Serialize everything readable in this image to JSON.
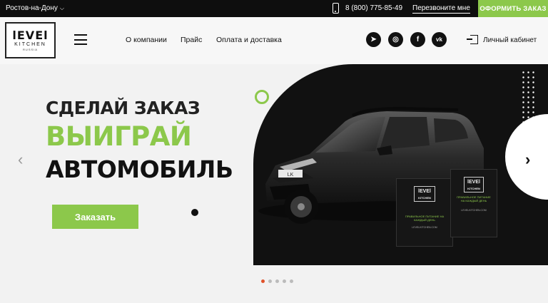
{
  "topbar": {
    "city": "Ростов-на-Дону",
    "phone": "8 (800) 775-85-49",
    "callback": "Перезвоните мне",
    "order_button": "ОФОРМИТЬ ЗАКАЗ"
  },
  "header": {
    "logo": {
      "main": "lEVEl",
      "sub": "KITCHEN",
      "sub2": "RUSSIA"
    },
    "nav": [
      "О компании",
      "Прайс",
      "Оплата и доставка"
    ],
    "social": [
      "telegram-icon",
      "instagram-icon",
      "facebook-icon",
      "vk-icon"
    ],
    "social_glyphs": [
      "➤",
      "◎",
      "f",
      "vk"
    ],
    "cabinet": "Личный кабинет"
  },
  "hero": {
    "line1": "СДЕЛАЙ ЗАКАЗ",
    "line2": "ВЫИГРАЙ",
    "line3": "АВТОМОБИЛЬ",
    "order_button": "Заказать",
    "bag_logo": "lEVEl",
    "bag_logo_sub": "KITCHEN",
    "bag_text": "ПРАВИЛЬНОЕ ПИТАНИЕ НА КАЖДЫЙ ДЕНЬ",
    "bag_url": "LEVELKITCHEN.COM",
    "car_badge": "LK"
  },
  "carousel": {
    "slides": 5,
    "active": 0
  },
  "colors": {
    "accent": "#8cc84b",
    "dark": "#111111",
    "pager_active": "#e0522b"
  }
}
